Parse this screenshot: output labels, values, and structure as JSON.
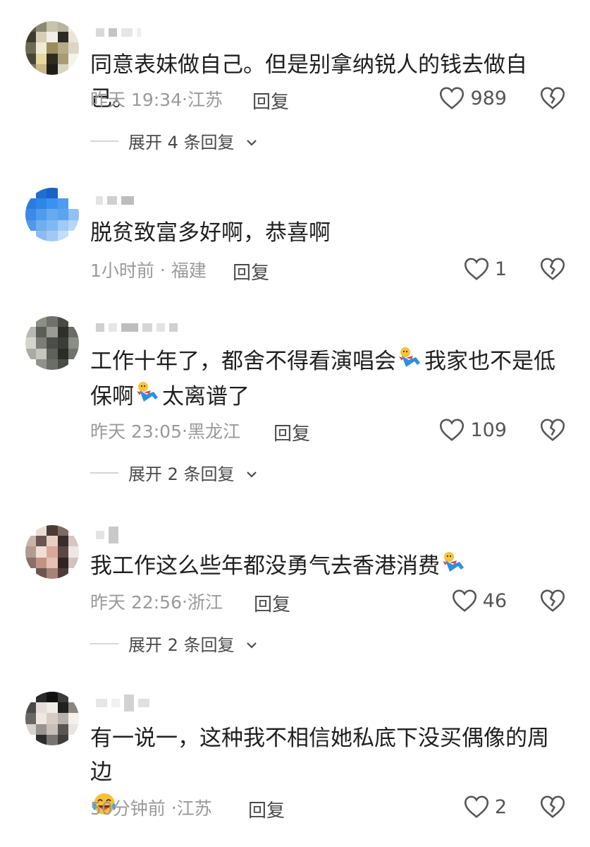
{
  "comments": [
    {
      "text": "同意表妹做自己。但是别拿纳锐人的钱去做自己。",
      "time": "昨天 19:34",
      "location": "江苏",
      "reply_label": "回复",
      "likes": "989",
      "expand": "展开 4 条回复"
    },
    {
      "text": "脱贫致富多好啊，恭喜啊",
      "time": "1小时前",
      "location": "福建",
      "reply_label": "回复",
      "likes": "1"
    },
    {
      "text_line1a": "工作十年了，都舍不得看演唱会",
      "text_line1b": "我家也不是低",
      "text_line2a": "保啊",
      "text_line2b": "太离谱了",
      "time": "昨天 23:05",
      "location": "黑龙江",
      "reply_label": "回复",
      "likes": "109",
      "expand": "展开 2 条回复"
    },
    {
      "text": "我工作这么些年都没勇气去香港消费",
      "time": "昨天 22:56",
      "location": "浙江",
      "reply_label": "回复",
      "likes": "46",
      "expand": "展开 2 条回复"
    },
    {
      "text": "有一说一，这种我不相信她私底下没买偶像的周边",
      "time": "50分钟前",
      "location": "江苏",
      "reply_label": "回复",
      "likes": "2"
    }
  ],
  "meta_separator": "·",
  "icons": {
    "like": "heart-outline-icon",
    "dislike": "broken-heart-icon",
    "expand": "chevron-down-icon",
    "emoji_fall": "falling-person-emoji",
    "emoji_laugh": "laughing-crying-emoji"
  },
  "colors": {
    "text": "#1f1f1f",
    "meta": "#9a9a9a",
    "action": "#4a4a4a"
  }
}
